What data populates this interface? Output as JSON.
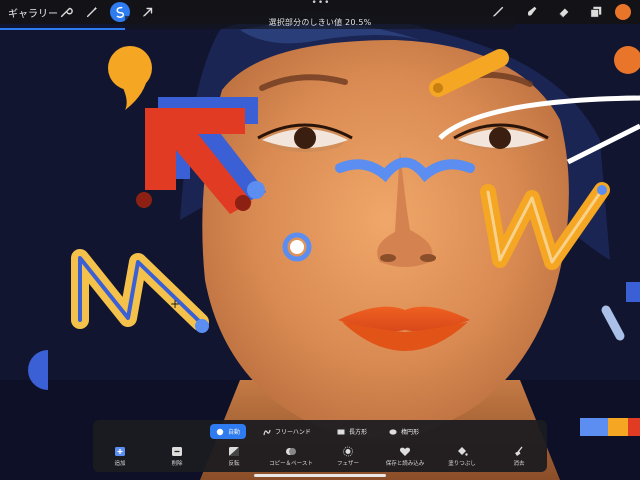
{
  "toolbar": {
    "gallery_label": "ギャラリー",
    "left_icons": [
      "wrench-icon",
      "magic-wand-icon",
      "selection-icon",
      "transform-arrow-icon"
    ],
    "right_icons": [
      "brush-icon",
      "smudge-icon",
      "eraser-icon",
      "layers-icon"
    ],
    "active_tool": "selection-icon",
    "current_color": "#e8752a",
    "threshold_label": "選択部分のしきい値 20.5%",
    "threshold_percent": 20.5
  },
  "selection_panel": {
    "modes": [
      {
        "label": "自動",
        "icon": "auto-selection-icon",
        "active": true
      },
      {
        "label": "フリーハンド",
        "icon": "freehand-icon",
        "active": false
      },
      {
        "label": "長方形",
        "icon": "rectangle-icon",
        "active": false
      },
      {
        "label": "楕円形",
        "icon": "ellipse-icon",
        "active": false
      }
    ],
    "actions": [
      {
        "label": "追加",
        "icon": "add-icon"
      },
      {
        "label": "削除",
        "icon": "remove-icon"
      },
      {
        "label": "反転",
        "icon": "invert-icon"
      },
      {
        "label": "コピー＆ペースト",
        "icon": "copy-paste-icon"
      },
      {
        "label": "フェザー",
        "icon": "feather-icon"
      },
      {
        "label": "保存と読み込み",
        "icon": "heart-icon"
      },
      {
        "label": "塗りつぶし",
        "icon": "fill-icon"
      },
      {
        "label": "消去",
        "icon": "clear-icon"
      }
    ]
  },
  "colors": {
    "accent": "#2f7cf0",
    "bg": "#101428",
    "skin": "#e0915a",
    "lips": "#e25318"
  }
}
